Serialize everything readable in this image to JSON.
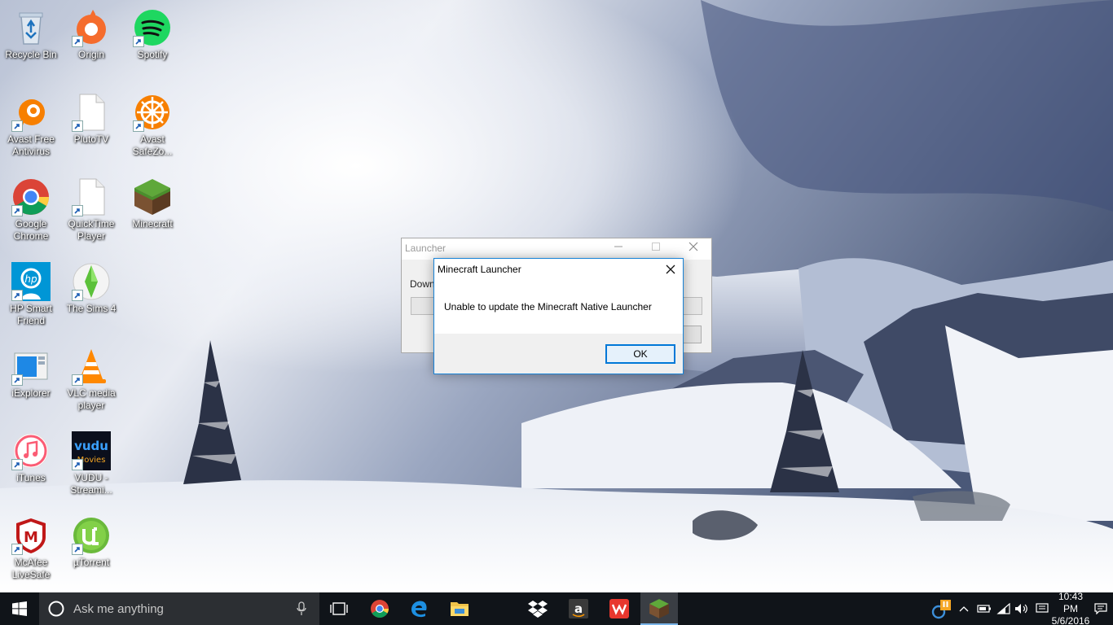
{
  "desktop": {
    "icons": [
      {
        "label": "Recycle Bin",
        "icon": "recycle-bin-icon"
      },
      {
        "label": "Origin",
        "icon": "origin-icon"
      },
      {
        "label": "Spotify",
        "icon": "spotify-icon"
      },
      {
        "label": "Avast Free Antivirus",
        "icon": "avast-icon"
      },
      {
        "label": "PlutoTV",
        "icon": "file-icon"
      },
      {
        "label": "Avast SafeZo...",
        "icon": "avast-safezone-icon"
      },
      {
        "label": "Google Chrome",
        "icon": "chrome-icon"
      },
      {
        "label": "QuickTime Player",
        "icon": "file-icon"
      },
      {
        "label": "Minecraft",
        "icon": "minecraft-icon"
      },
      {
        "label": "HP Smart Friend",
        "icon": "hp-smart-friend-icon"
      },
      {
        "label": "The Sims 4",
        "icon": "sims-icon"
      },
      {
        "label": "iExplorer",
        "icon": "iexplorer-icon"
      },
      {
        "label": "VLC media player",
        "icon": "vlc-icon"
      },
      {
        "label": "iTunes",
        "icon": "itunes-icon"
      },
      {
        "label": "VUDU - Streami...",
        "icon": "vudu-icon"
      },
      {
        "label": "McAfee LiveSafe",
        "icon": "mcafee-icon"
      },
      {
        "label": "µTorrent",
        "icon": "utorrent-icon"
      }
    ]
  },
  "launcher_window": {
    "title": "Launcher",
    "body_text": "Downl"
  },
  "dialog": {
    "title": "Minecraft Launcher",
    "message": "Unable to update the Minecraft Native Launcher",
    "ok_label": "OK"
  },
  "taskbar": {
    "search_placeholder": "Ask me anything",
    "pinned": [
      "chrome-icon",
      "edge-icon",
      "file-explorer-icon",
      "dropbox-icon",
      "amazon-icon",
      "wps-office-icon",
      "minecraft-icon"
    ],
    "clock_time": "10:43 PM",
    "clock_date": "5/6/2016"
  },
  "colors": {
    "accent": "#0078d7",
    "taskbar": "#101419",
    "dialog_border": "#1883d7"
  }
}
